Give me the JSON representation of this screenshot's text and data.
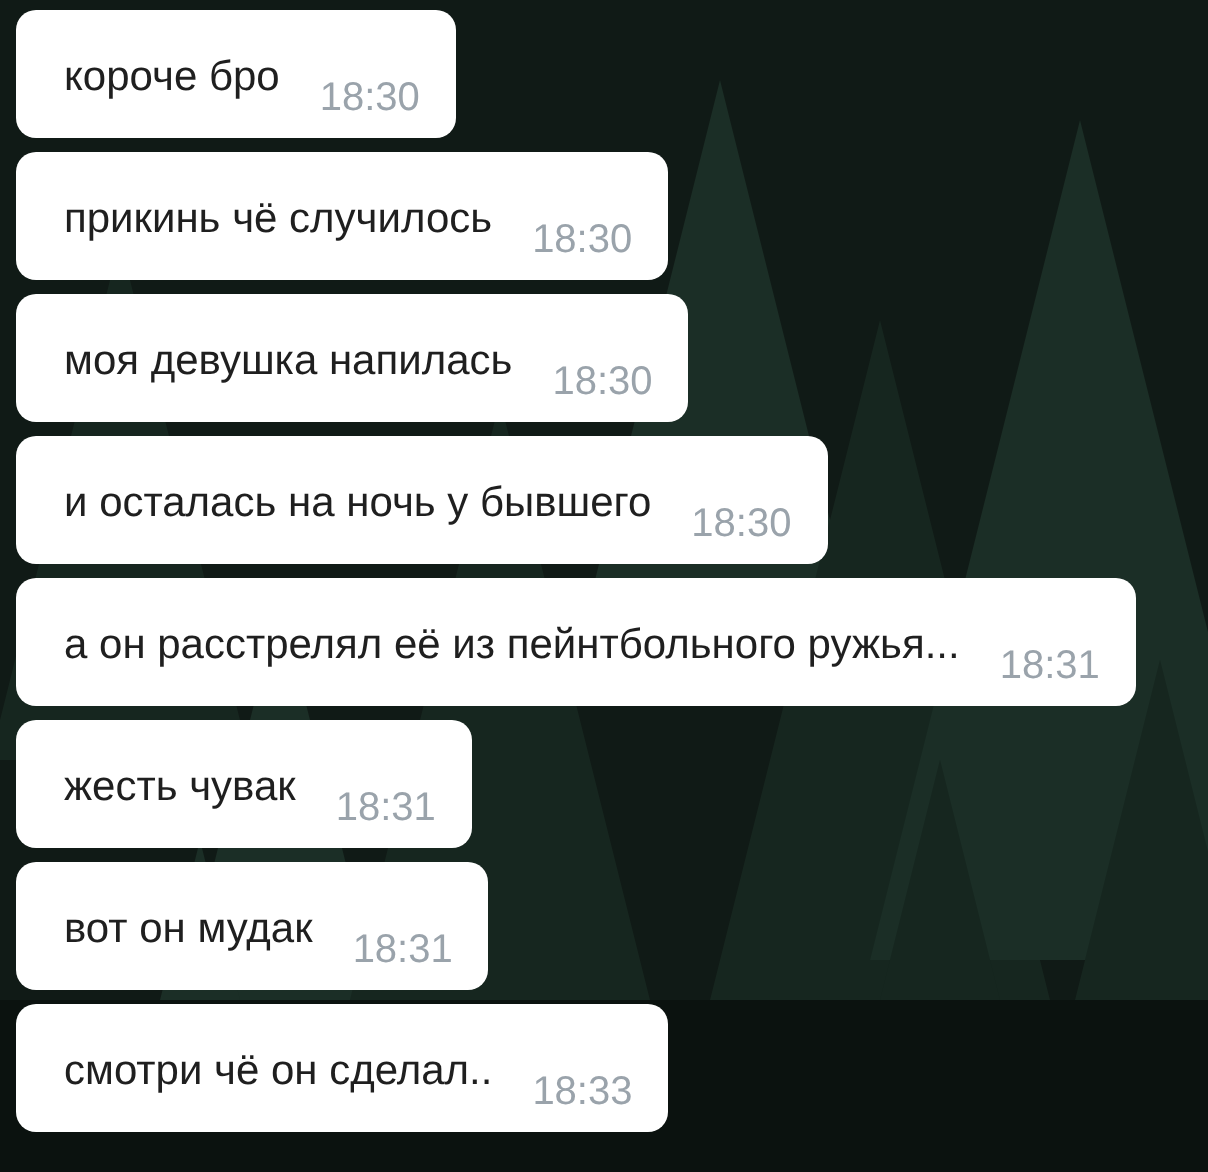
{
  "messages": [
    {
      "text": "короче бро",
      "time": "18:30"
    },
    {
      "text": "прикинь чё случилось",
      "time": "18:30"
    },
    {
      "text": "моя девушка напилась",
      "time": "18:30"
    },
    {
      "text": "и осталась на ночь у бывшего",
      "time": "18:30"
    },
    {
      "text": "а он расстрелял её из пейнтбольного ружья...",
      "time": "18:31"
    },
    {
      "text": "жесть чувак",
      "time": "18:31"
    },
    {
      "text": "вот он мудак",
      "time": "18:31"
    },
    {
      "text": "смотри чё он сделал..",
      "time": "18:33"
    }
  ]
}
